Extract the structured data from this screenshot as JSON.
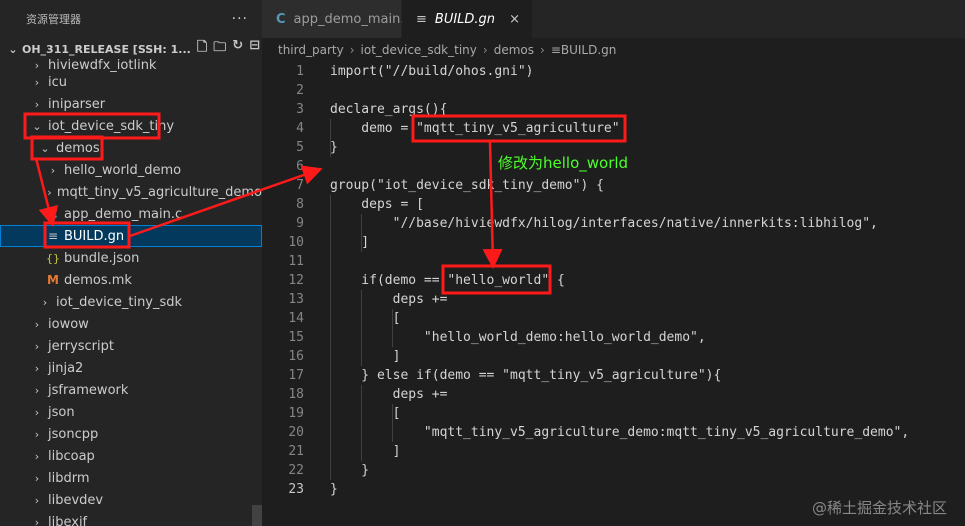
{
  "explorer": {
    "header": "资源管理器",
    "more": "···",
    "project": "OH_311_RELEASE [SSH: 1...",
    "rows": [
      {
        "label": "hiviewdfx_iotlink",
        "indent": 1,
        "kind": "folder-collapsed"
      },
      {
        "label": "icu",
        "indent": 1,
        "kind": "folder-collapsed"
      },
      {
        "label": "iniparser",
        "indent": 1,
        "kind": "folder-collapsed"
      },
      {
        "label": "iot_device_sdk_tiny",
        "indent": 1,
        "kind": "folder-open"
      },
      {
        "label": "demos",
        "indent": 2,
        "kind": "folder-open"
      },
      {
        "label": "hello_world_demo",
        "indent": 3,
        "kind": "folder-collapsed"
      },
      {
        "label": "mqtt_tiny_v5_agriculture_demo",
        "indent": 3,
        "kind": "folder-collapsed"
      },
      {
        "label": "app_demo_main.c",
        "indent": 3,
        "kind": "c"
      },
      {
        "label": "BUILD.gn",
        "indent": 3,
        "kind": "gn",
        "selected": true
      },
      {
        "label": "bundle.json",
        "indent": 3,
        "kind": "json"
      },
      {
        "label": "demos.mk",
        "indent": 3,
        "kind": "mk"
      },
      {
        "label": "iot_device_tiny_sdk",
        "indent": 2,
        "kind": "folder-collapsed"
      },
      {
        "label": "iowow",
        "indent": 1,
        "kind": "folder-collapsed"
      },
      {
        "label": "jerryscript",
        "indent": 1,
        "kind": "folder-collapsed"
      },
      {
        "label": "jinja2",
        "indent": 1,
        "kind": "folder-collapsed"
      },
      {
        "label": "jsframework",
        "indent": 1,
        "kind": "folder-collapsed"
      },
      {
        "label": "json",
        "indent": 1,
        "kind": "folder-collapsed"
      },
      {
        "label": "jsoncpp",
        "indent": 1,
        "kind": "folder-collapsed"
      },
      {
        "label": "libcoap",
        "indent": 1,
        "kind": "folder-collapsed"
      },
      {
        "label": "libdrm",
        "indent": 1,
        "kind": "folder-collapsed"
      },
      {
        "label": "libevdev",
        "indent": 1,
        "kind": "folder-collapsed"
      },
      {
        "label": "libexif",
        "indent": 1,
        "kind": "folder-collapsed"
      }
    ]
  },
  "tabs": [
    {
      "label": "app_demo_main.c",
      "icon": "c-file-icon",
      "active": false
    },
    {
      "label": "BUILD.gn",
      "icon": "gn-file-icon",
      "active": true,
      "close": "×"
    }
  ],
  "breadcrumb": [
    "third_party",
    "iot_device_sdk_tiny",
    "demos",
    "BUILD.gn"
  ],
  "editor": {
    "current_line": 23,
    "lines": [
      "import(\"//build/ohos.gni\")",
      "",
      "declare_args(){",
      "    demo = \"mqtt_tiny_v5_agriculture\"",
      "}",
      "",
      "group(\"iot_device_sdk_tiny_demo\") {",
      "    deps = [",
      "        \"//base/hiviewdfx/hilog/interfaces/native/innerkits:libhilog\",",
      "    ]",
      "",
      "    if(demo == \"hello_world\" {",
      "        deps +=",
      "        [",
      "            \"hello_world_demo:hello_world_demo\",",
      "        ]",
      "    } else if(demo == \"mqtt_tiny_v5_agriculture\"){",
      "        deps +=",
      "        [",
      "            \"mqtt_tiny_v5_agriculture_demo:mqtt_tiny_v5_agriculture_demo\",",
      "        ]",
      "    }",
      "}"
    ]
  },
  "annotation": {
    "text": "修改为hello_world",
    "color": "#4cff2a"
  },
  "watermark": "@稀土掘金技术社区",
  "colors": {
    "highlight_box": "#ff1a1a",
    "selection": "#04395e",
    "accent": "#007fd4"
  }
}
